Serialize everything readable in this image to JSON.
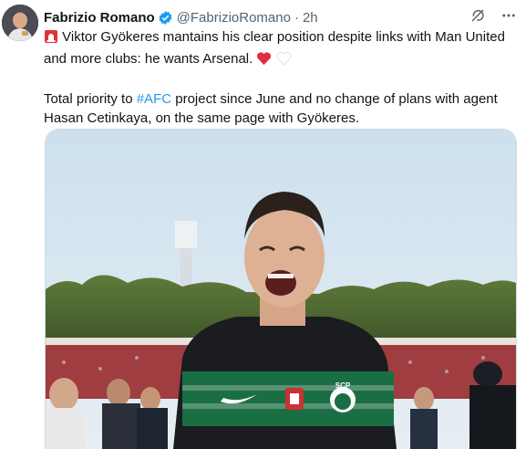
{
  "author": {
    "name": "Fabrizio Romano",
    "handle": "@FabrizioRomano",
    "separator": "·",
    "time": "2h"
  },
  "tweet": {
    "line1_text": "Viktor Gyökeres mantains his clear position despite links with Man United and more clubs: he wants Arsenal.",
    "para2_before": "Total priority to ",
    "hashtag": "#AFC",
    "para2_after": " project since June and no change of plans with agent Hasan Cetinkaya, on the same page with Gyökeres."
  },
  "icons": {
    "siren": "siren-emoji-icon",
    "red_heart": "red-heart-emoji-icon",
    "white_heart": "white-heart-emoji-icon",
    "verified": "verified-badge-icon",
    "grok": "grok-icon",
    "more": "more-icon"
  },
  "colors": {
    "accent": "#1d9bf0",
    "text": "#0f1419",
    "secondary": "#536471"
  },
  "media": {
    "jersey_badge_text": "SCP",
    "jersey_badge_subtext": "SPORTING"
  }
}
